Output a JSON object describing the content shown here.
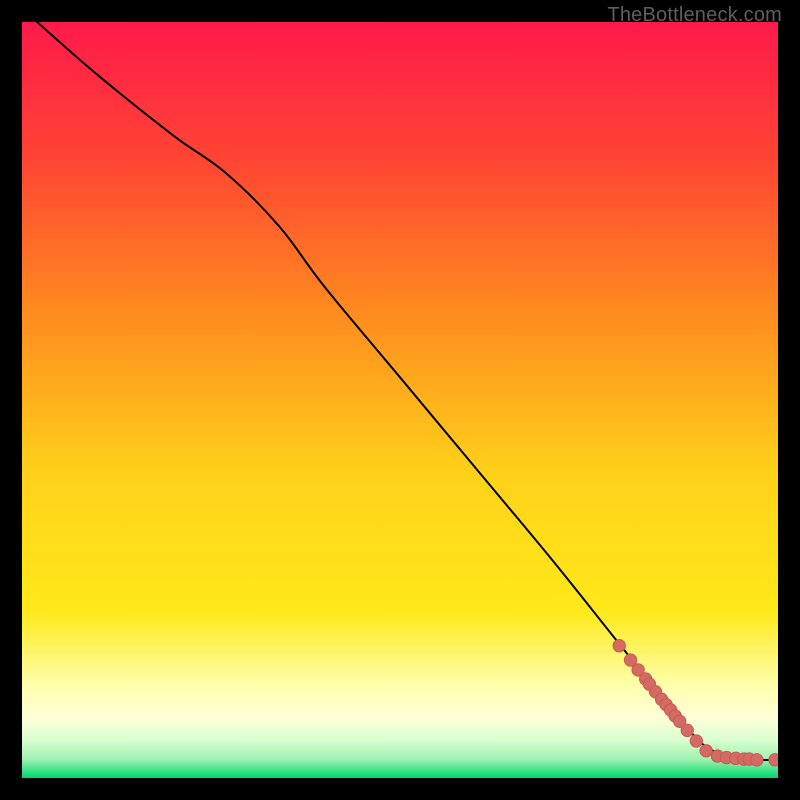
{
  "watermark": "TheBottleneck.com",
  "colors": {
    "frame": "#000000",
    "gradient_top": "#ff1a4b",
    "gradient_mid_up": "#ff8a1f",
    "gradient_mid": "#ffe91a",
    "gradient_low": "#ffffb0",
    "gradient_band": "#d9ffd0",
    "gradient_bottom": "#00d86f",
    "line": "#000000",
    "point_fill": "#d36a63",
    "point_stroke": "#c95a53"
  },
  "chart_data": {
    "type": "line",
    "title": "",
    "xlabel": "",
    "ylabel": "",
    "xlim": [
      0,
      100
    ],
    "ylim": [
      0,
      100
    ],
    "grid": false,
    "legend": false,
    "series": [
      {
        "name": "curve",
        "x": [
          2,
          10,
          20,
          27,
          34,
          40,
          50,
          60,
          70,
          78,
          84,
          87,
          90,
          94,
          98,
          100
        ],
        "y": [
          100,
          93,
          85,
          80,
          73,
          65,
          53,
          41,
          29,
          19,
          11.5,
          8,
          4.5,
          2.6,
          2.4,
          2.4
        ]
      }
    ],
    "points": {
      "name": "tail-points",
      "x": [
        79,
        80.5,
        81.5,
        82.5,
        83,
        83.8,
        84.6,
        85.2,
        85.8,
        86.4,
        87,
        88,
        89.2,
        90.5,
        92,
        93.2,
        94.4,
        95.5,
        96.2,
        97.2,
        99.6
      ],
      "y": [
        17.5,
        15.6,
        14.3,
        13.1,
        12.4,
        11.4,
        10.4,
        9.7,
        9.0,
        8.2,
        7.5,
        6.3,
        4.9,
        3.6,
        2.9,
        2.7,
        2.6,
        2.5,
        2.5,
        2.4,
        2.4
      ]
    }
  }
}
